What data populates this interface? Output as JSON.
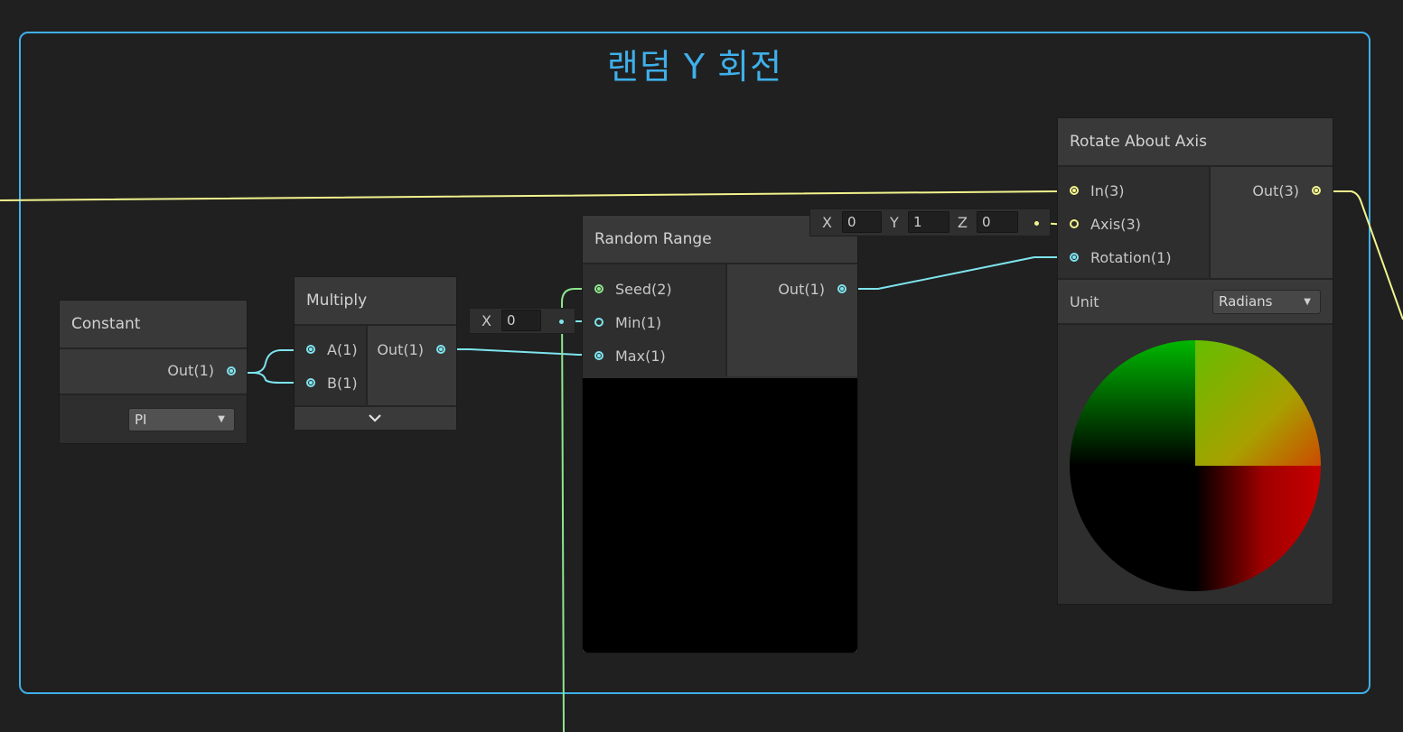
{
  "group": {
    "title": "랜덤 Y 회전",
    "color": "#3fb0ea"
  },
  "nodes": {
    "constant": {
      "title": "Constant",
      "out_label": "Out(1)",
      "dropdown_value": "PI"
    },
    "multiply": {
      "title": "Multiply",
      "in_a": "A(1)",
      "in_b": "B(1)",
      "out_label": "Out(1)",
      "expand_icon": "chevron-down-icon"
    },
    "random_range": {
      "title": "Random Range",
      "in_seed": "Seed(2)",
      "in_min": "Min(1)",
      "in_max": "Max(1)",
      "out_label": "Out(1)",
      "min_field": {
        "label": "X",
        "value": "0"
      }
    },
    "rotate_about_axis": {
      "title": "Rotate About Axis",
      "in_in": "In(3)",
      "in_axis": "Axis(3)",
      "in_rotation": "Rotation(1)",
      "out_label": "Out(3)",
      "unit_label": "Unit",
      "unit_value": "Radians",
      "axis_field": {
        "x_label": "X",
        "x_value": "0",
        "y_label": "Y",
        "y_value": "1",
        "z_label": "Z",
        "z_value": "0"
      }
    }
  },
  "colors": {
    "float_wire": "#7ee4ee",
    "vector3_wire": "#f3f38e",
    "vector2_wire": "#8ee68e"
  }
}
